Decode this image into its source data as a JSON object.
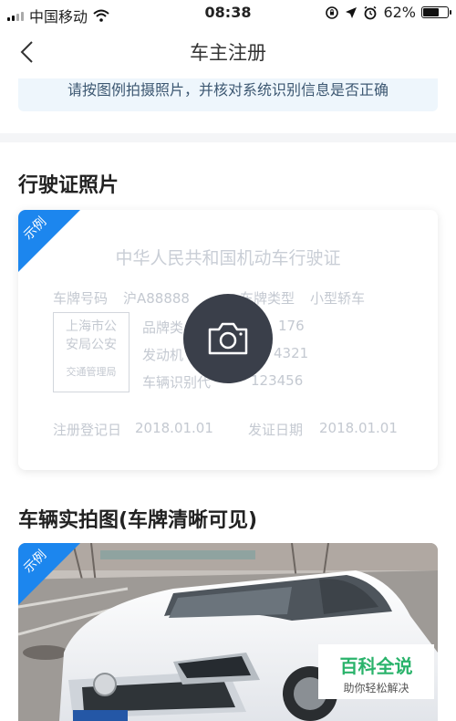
{
  "status": {
    "carrier": "中国移动",
    "time": "08:38",
    "battery_percent": "62%",
    "battery_level": 0.62,
    "icons": [
      "signal-icon",
      "wifi-icon",
      "rotation-lock-icon",
      "location-arrow-icon",
      "alarm-icon",
      "battery-icon"
    ]
  },
  "nav": {
    "title": "车主注册",
    "back_icon": "chevron-left-icon"
  },
  "notice": {
    "text": "请按图例拍摄照片，并核对系统识别信息是否正确"
  },
  "license_section": {
    "title": "行驶证照片",
    "tag": "示例",
    "card_title": "中华人民共和国机动车行驶证",
    "plate_label": "车牌号码",
    "plate_value": "沪A88888",
    "type_label": "车牌类型",
    "type_value": "小型轿车",
    "stamp_line1": "上海市公",
    "stamp_line2": "安局公安",
    "stamp_line3": "交通管理局",
    "brand_label": "品牌类",
    "brand_value": "176",
    "engine_label": "发动机",
    "engine_value": "4321",
    "vin_label": "车辆识别代",
    "vin_value": "123456",
    "reg_date_label": "注册登记日",
    "reg_date_value": "2018.01.01",
    "issue_date_label": "发证日期",
    "issue_date_value": "2018.01.01",
    "camera_icon": "camera-icon"
  },
  "photo_section": {
    "title": "车辆实拍图(车牌清晰可见)",
    "tag": "示例"
  },
  "watermark": {
    "title": "百科全说",
    "subtitle": "助你轻松解决"
  },
  "colors": {
    "accent": "#1c86ee",
    "notice_bg": "#eef6fc",
    "notice_text": "#3d5872",
    "camera_bg": "#3a3f4a",
    "watermark_green": "#2ab36b"
  }
}
